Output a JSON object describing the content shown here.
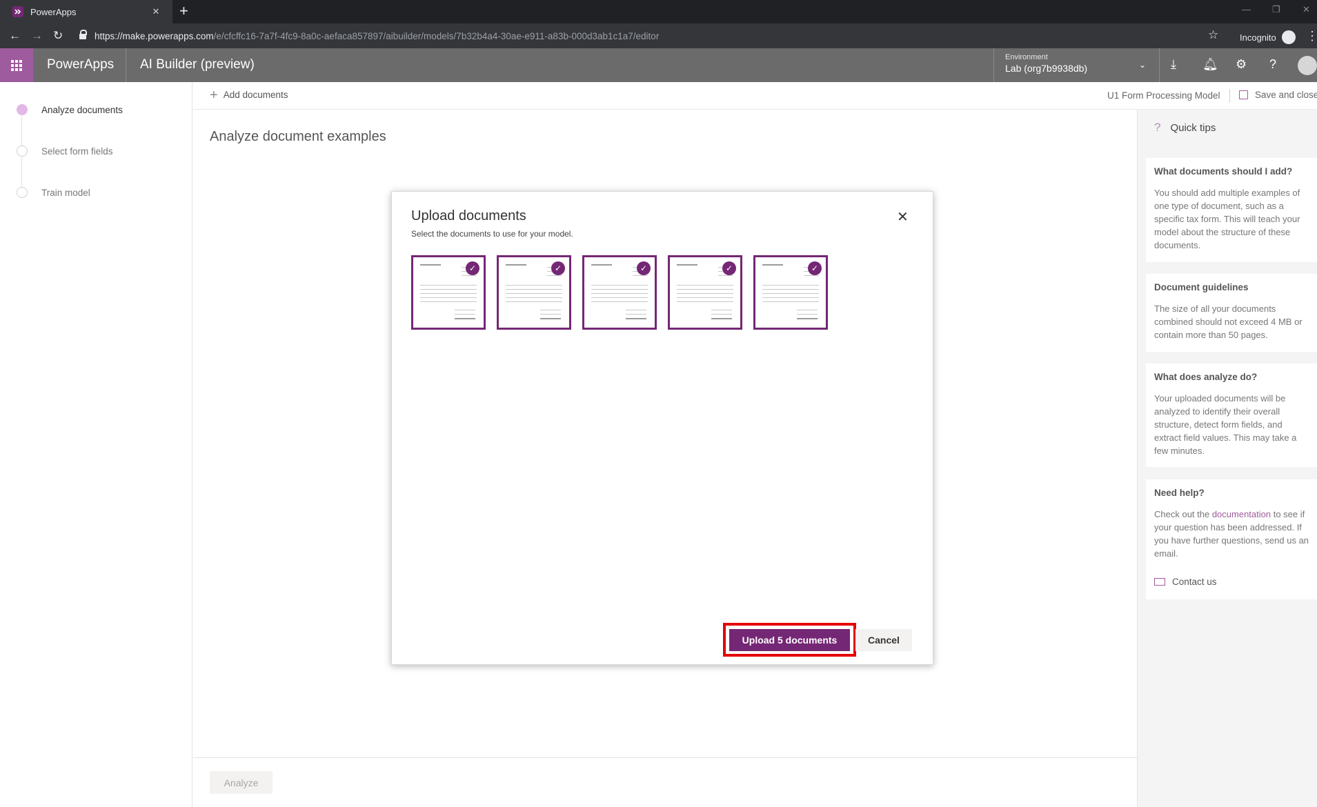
{
  "browser": {
    "tab_title": "PowerApps",
    "tab_close": "✕",
    "new_tab": "+",
    "url_host": "https://make.powerapps.com",
    "url_path": "/e/cfcffc16-7a7f-4fc9-8a0c-aefaca857897/aibuilder/models/7b32b4a4-30ae-e911-a83b-000d3ab1c1a7/editor",
    "incognito_label": "Incognito"
  },
  "header": {
    "app_name": "PowerApps",
    "product": "AI Builder (preview)",
    "environment_label": "Environment",
    "environment_value": "Lab (org7b9938db)"
  },
  "steps": [
    {
      "label": "Analyze documents",
      "state": "active"
    },
    {
      "label": "Select form fields",
      "state": "inactive"
    },
    {
      "label": "Train model",
      "state": "inactive"
    }
  ],
  "commandbar": {
    "add_documents": "Add documents",
    "model_name": "U1 Form Processing Model",
    "save_close": "Save and close"
  },
  "main": {
    "title": "Analyze document examples",
    "analyze_button": "Analyze"
  },
  "quick_tips": {
    "heading": "Quick tips",
    "cards": [
      {
        "title": "What documents should I add?",
        "body": "You should add multiple examples of one type of document, such as a specific tax form. This will teach your model about the structure of these documents."
      },
      {
        "title": "Document guidelines",
        "body": "The size of all your documents combined should not exceed 4 MB or contain more than 50 pages."
      },
      {
        "title": "What does analyze do?",
        "body": "Your uploaded documents will be analyzed to identify their overall structure, detect form fields, and extract field values. This may take a few minutes."
      },
      {
        "title": "Need help?",
        "body_before": "Check out the ",
        "link": "documentation",
        "body_after": " to see if your question has been addressed. If you have further questions, send us an email.",
        "contact": "Contact us"
      }
    ]
  },
  "modal": {
    "title": "Upload documents",
    "subtitle": "Select the documents to use for your model.",
    "close_icon": "✕",
    "documents_selected": [
      true,
      true,
      true,
      true,
      true
    ],
    "upload_button": "Upload 5 documents",
    "cancel_button": "Cancel"
  },
  "colors": {
    "accent": "#742774",
    "header_bg": "#6b6b6b",
    "waffle_bg": "#9e5b9e",
    "highlight": "#e50000"
  }
}
